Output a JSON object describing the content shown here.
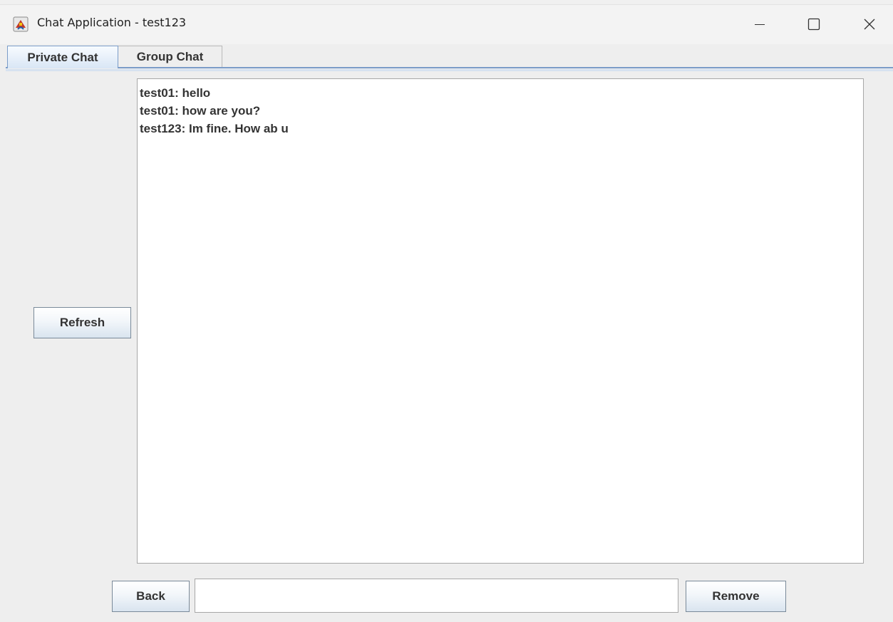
{
  "window": {
    "title": "Chat Application - test123",
    "controls": {
      "minimize": "minimize-icon",
      "maximize": "maximize-icon",
      "close": "close-icon"
    }
  },
  "tabs": [
    {
      "label": "Private Chat",
      "selected": true
    },
    {
      "label": "Group Chat",
      "selected": false
    }
  ],
  "messages": [
    "test01: hello",
    "test01: how are you?",
    "test123: Im fine. How ab u"
  ],
  "buttons": {
    "refresh": "Refresh",
    "back": "Back",
    "remove": "Remove"
  },
  "input": {
    "value": "",
    "placeholder": ""
  },
  "colors": {
    "tab_accent": "#7b9cc8",
    "background": "#eeeeee"
  }
}
